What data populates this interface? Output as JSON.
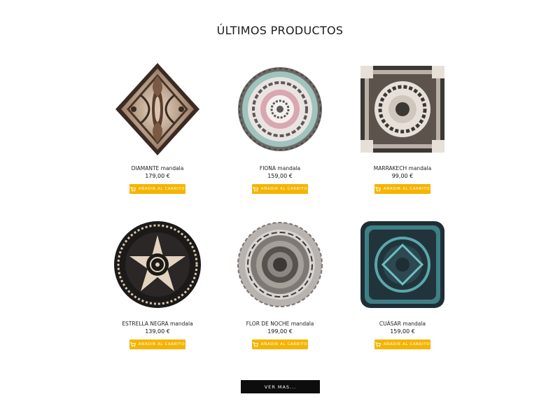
{
  "section": {
    "title": "ÚLTIMOS PRODUCTOS"
  },
  "products": [
    {
      "name": "DIAMANTE mandala",
      "price": "179,00 €",
      "button": "AÑADIR AL CARRITO",
      "icon": "diamond-mandala-image"
    },
    {
      "name": "FIONA mandala",
      "price": "159,00 €",
      "button": "AÑADIR AL CARRITO",
      "icon": "round-mandala-image"
    },
    {
      "name": "MARRAKECH mandala",
      "price": "99,00 €",
      "button": "AÑADIR AL CARRITO",
      "icon": "square-mandala-image"
    },
    {
      "name": "ESTRELLA NEGRA mandala",
      "price": "139,00 €",
      "button": "AÑADIR AL CARRITO",
      "icon": "round-mandala-image"
    },
    {
      "name": "FLOR DE NOCHE mandala",
      "price": "199,00 €",
      "button": "AÑADIR AL CARRITO",
      "icon": "flower-mandala-image"
    },
    {
      "name": "CUÁSAR mandala",
      "price": "159,00 €",
      "button": "AÑADIR AL CARRITO",
      "icon": "square-mandala-image"
    }
  ],
  "more": {
    "label": "VER MAS..."
  },
  "colors": {
    "accent": "#f5b400",
    "dark": "#0d0d0d"
  }
}
